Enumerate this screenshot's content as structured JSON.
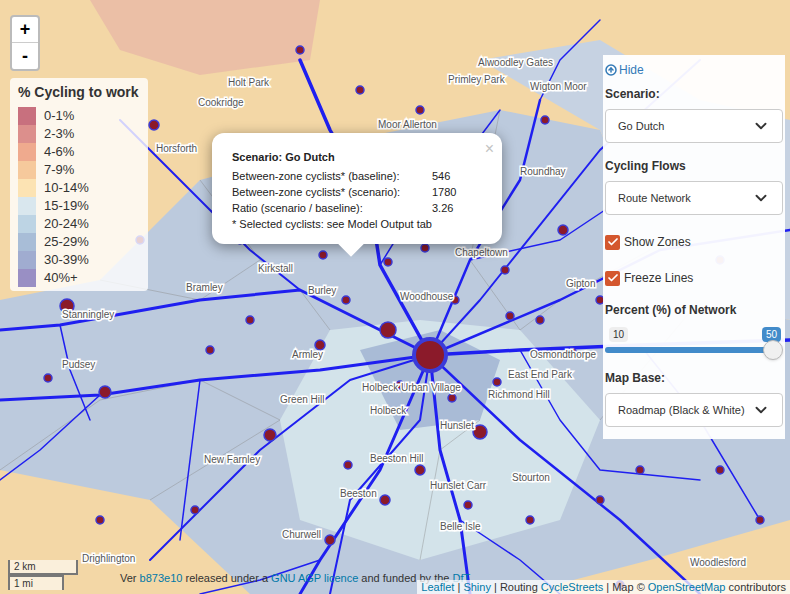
{
  "map": {
    "zoom": [
      "+",
      "-"
    ],
    "places": [
      "Holt Park",
      "Alwoodley Gates",
      "Wigton Moor",
      "Primley Park",
      "Cookridge",
      "Moor Allerton",
      "Horsforth",
      "Roundhay",
      "Chapeltown",
      "Gipton",
      "Kirkstall",
      "Bramley",
      "Burley",
      "Woodhouse",
      "Stanningley",
      "Pudsey",
      "Armley",
      "Osmondthorpe",
      "East End Park",
      "Richmond Hill",
      "Holbeck Urban Village",
      "Green Hill",
      "Holbeck",
      "Hunslet",
      "New Farnley",
      "Beeston Hill",
      "Stourton",
      "Hunslet Carr",
      "Beeston",
      "Belle Isle",
      "Churwell",
      "Drighlington",
      "Woodlesford"
    ],
    "scale": {
      "metric": "2 km",
      "imperial": "1 mi"
    }
  },
  "legend": {
    "title": "% Cycling to work",
    "items": [
      {
        "label": "0-1%",
        "color": "#c8707e"
      },
      {
        "label": "2-3%",
        "color": "#dc8f8c"
      },
      {
        "label": "4-6%",
        "color": "#efaa8e"
      },
      {
        "label": "7-9%",
        "color": "#f6c99c"
      },
      {
        "label": "10-14%",
        "color": "#fce3b3"
      },
      {
        "label": "15-19%",
        "color": "#d9e7ee"
      },
      {
        "label": "20-24%",
        "color": "#bdd4e4"
      },
      {
        "label": "25-29%",
        "color": "#a8bdd7"
      },
      {
        "label": "30-39%",
        "color": "#a0acd0"
      },
      {
        "label": "40%+",
        "color": "#998fc4"
      }
    ]
  },
  "popup": {
    "title": "Scenario: Go Dutch",
    "close": "×",
    "rows": [
      {
        "label": "Between-zone cyclists* (baseline):",
        "value": "546"
      },
      {
        "label": "Between-zone cyclists* (scenario):",
        "value": "1780"
      },
      {
        "label": "Ratio (scenario / baseline):",
        "value": "3.26"
      }
    ],
    "note": "* Selected cyclists: see Model Output tab"
  },
  "controls": {
    "hide": "Hide",
    "scenario": {
      "label": "Scenario:",
      "value": "Go Dutch"
    },
    "flows": {
      "label": "Cycling Flows",
      "value": "Route Network"
    },
    "checkboxes": [
      {
        "label": "Show Zones",
        "checked": true
      },
      {
        "label": "Freeze Lines",
        "checked": true
      }
    ],
    "percent": {
      "label": "Percent (%) of Network",
      "min": "10",
      "max": "50",
      "level": 1
    },
    "mapBase": {
      "label": "Map Base:",
      "value": "Roadmap (Black & White)"
    }
  },
  "attribution": {
    "left": [
      {
        "text": "Ver ",
        "link": false
      },
      {
        "text": "b873e10",
        "link": true
      },
      {
        "text": " released under a ",
        "link": false
      },
      {
        "text": "GNU AGP licence",
        "link": true
      },
      {
        "text": " and funded by the ",
        "link": false
      },
      {
        "text": "DfT",
        "link": true
      }
    ],
    "right": [
      {
        "text": "Leaflet",
        "link": true
      },
      {
        "text": " | ",
        "link": false
      },
      {
        "text": "Shiny",
        "link": true
      },
      {
        "text": " | Routing ",
        "link": false
      },
      {
        "text": "CycleStreets",
        "link": true
      },
      {
        "text": " | Map © ",
        "link": false
      },
      {
        "text": "OpenStreetMap",
        "link": true
      },
      {
        "text": " contributors",
        "link": false
      }
    ]
  }
}
